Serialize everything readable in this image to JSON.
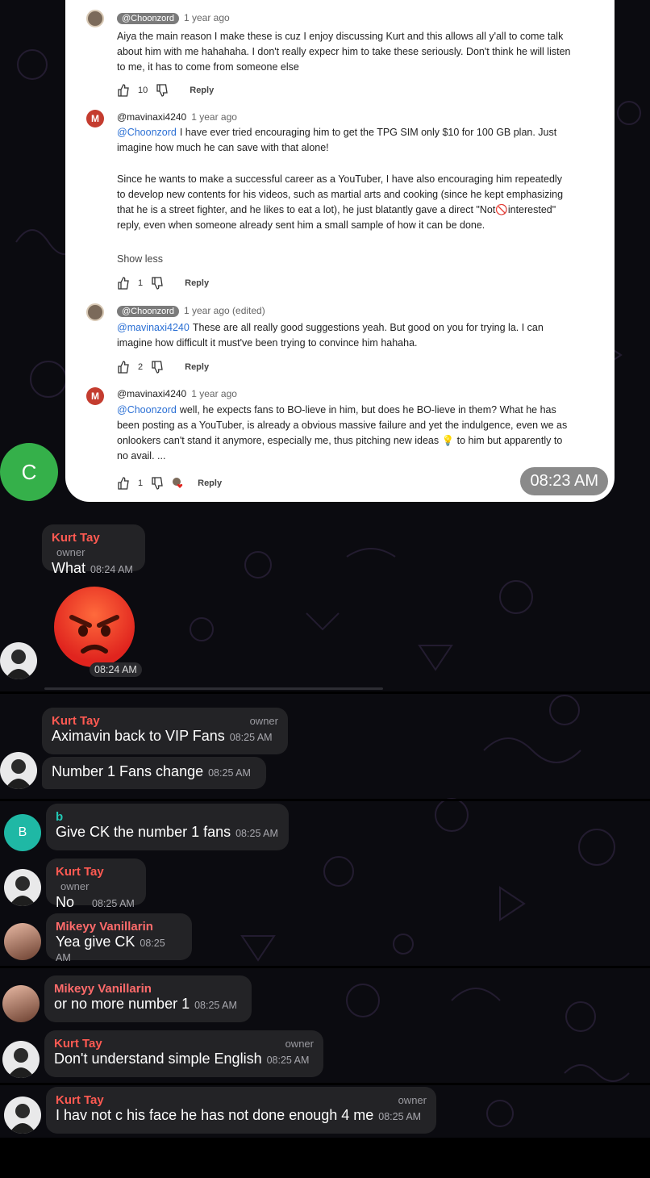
{
  "colors": {
    "kurt_name": "#ff5a52",
    "mikeyy_name": "#ff6b6b",
    "b_name": "#22c8b4",
    "chat_bg": "#0b0b10",
    "bubble_bg": "#232326"
  },
  "card": {
    "time": "08:23 AM",
    "comments": [
      {
        "handle": "@Choonzord",
        "age": "1 year ago",
        "mention": "",
        "text": "Aiya the main reason I make these is cuz I enjoy discussing Kurt and this allows all y'all to come talk about him with me hahahaha. I don't really expecr him to take these seriously. Don't think he will listen to me, it has to come from someone else",
        "likes": "10",
        "reply": "Reply"
      },
      {
        "handle": "@mavinaxi4240",
        "age": "1 year ago",
        "mention": "@Choonzord",
        "text": "I have ever tried encouraging him to get the TPG SIM only $10 for 100 GB plan. Just imagine how much he can save with that alone!",
        "text2": "Since he wants to make a successful career as a YouTuber, I have also encouraging him repeatedly to develop new contents for his videos, such as martial arts and cooking (since he kept emphasizing that he is a street fighter, and he likes to eat a lot), he just blatantly gave a direct \"Not🚫interested\" reply, even when someone already sent him a small sample of how it can be done.",
        "showless": "Show less",
        "likes": "1",
        "reply": "Reply",
        "avatar_letter": "M"
      },
      {
        "handle": "@Choonzord",
        "age": "1 year ago (edited)",
        "mention": "@mavinaxi4240",
        "text": "These are all really good suggestions yeah. But good on you for trying la. I can imagine how difficult it must've been trying to convince him hahaha.",
        "likes": "2",
        "reply": "Reply"
      },
      {
        "handle": "@mavinaxi4240",
        "age": "1 year ago",
        "mention": "@Choonzord",
        "text": "well, he expects fans to BO-lieve in him, but does he BO-lieve in them? What he has been posting as a YouTuber, is already a obvious massive failure and yet the indulgence, even we as onlookers can't stand it anymore, especially me, thus pitching new ideas 💡 to him but apparently to no avail. ...",
        "likes": "1",
        "reply": "Reply",
        "avatar_letter": "M"
      }
    ]
  },
  "sender_c": {
    "letter": "C"
  },
  "messages": [
    {
      "name": "Kurt Tay",
      "owner": "owner",
      "text": "What",
      "time": "08:24 AM"
    },
    {
      "emoji": "😡",
      "time": "08:24 AM"
    },
    {
      "name": "Kurt Tay",
      "owner": "owner",
      "text": "Aximavin back to VIP Fans",
      "time": "08:25 AM"
    },
    {
      "text": "Number 1 Fans change",
      "time": "08:25 AM"
    },
    {
      "name": "b",
      "avatar_letter": "B",
      "text": "Give CK the number 1 fans",
      "time": "08:25 AM"
    },
    {
      "name": "Kurt Tay",
      "owner": "owner",
      "text": "No",
      "time": "08:25 AM"
    },
    {
      "name": "Mikeyy Vanillarin",
      "text": "Yea give CK",
      "time": "08:25 AM"
    },
    {
      "name": "Mikeyy Vanillarin",
      "text": "or no more number 1",
      "time": "08:25 AM"
    },
    {
      "name": "Kurt Tay",
      "owner": "owner",
      "text": "Don't understand simple English",
      "time": "08:25 AM"
    },
    {
      "name": "Kurt Tay",
      "owner": "owner",
      "text": "I hav not c his face he has not done enough 4 me",
      "time": "08:25 AM"
    }
  ]
}
